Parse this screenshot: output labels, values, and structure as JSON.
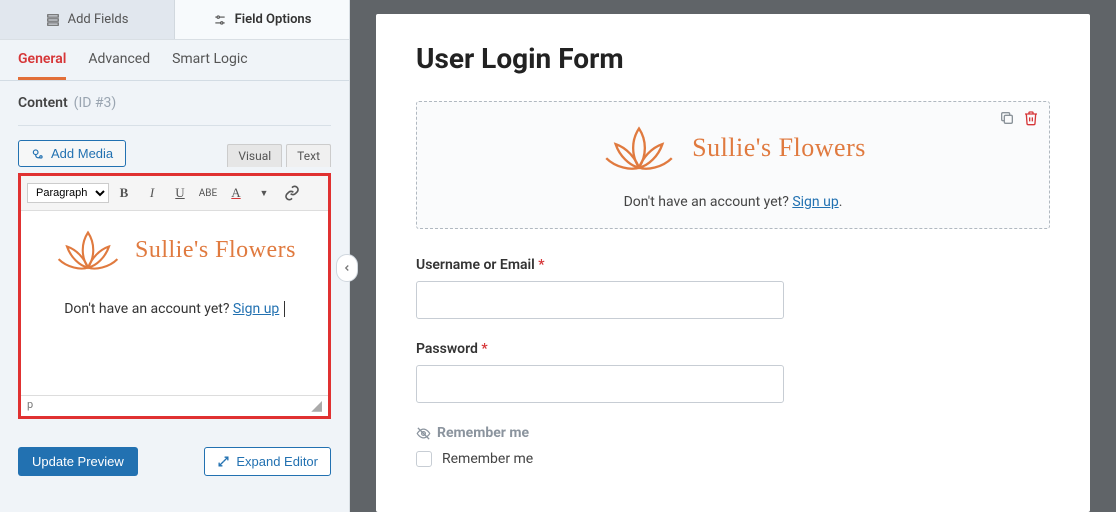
{
  "sidebar": {
    "top_tabs": {
      "add_fields": "Add Fields",
      "field_options": "Field Options"
    },
    "sub_tabs": {
      "general": "General",
      "advanced": "Advanced",
      "smart_logic": "Smart Logic"
    },
    "panel_title": "Content",
    "panel_id": "(ID #3)",
    "add_media": "Add Media",
    "editor_tabs": {
      "visual": "Visual",
      "text": "Text"
    },
    "format_option": "Paragraph",
    "brand_name": "Sullie's Flowers",
    "caption_pre": "Don't have an account yet? ",
    "caption_link": "Sign up",
    "statusbar_path": "p",
    "update_preview": "Update Preview",
    "expand_editor": "Expand Editor"
  },
  "preview": {
    "form_title": "User Login Form",
    "brand_name": "Sullie's Flowers",
    "caption_pre": "Don't have an account yet? ",
    "caption_link": "Sign up",
    "caption_post": ".",
    "username_label": "Username or Email",
    "password_label": "Password",
    "remember_section": "Remember me",
    "remember_option": "Remember me"
  },
  "colors": {
    "accent": "#e07a3f",
    "link": "#2271b1",
    "danger": "#d63638"
  }
}
